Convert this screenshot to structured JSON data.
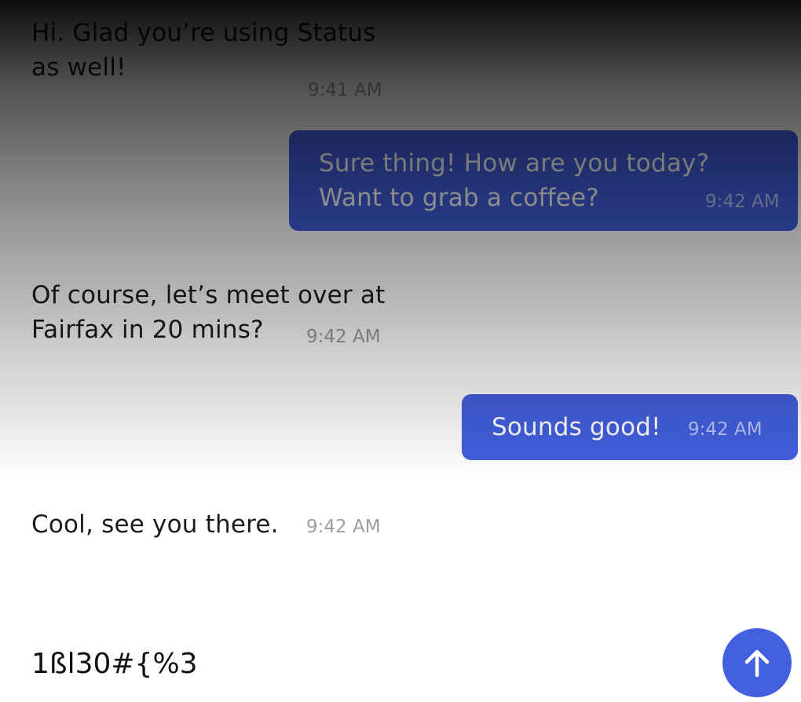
{
  "messages": [
    {
      "text": "Hi. Glad you’re using Status as well!",
      "time": "9:41 AM",
      "direction": "incoming"
    },
    {
      "text": "Sure thing! How are you today? Want to grab a coffee?",
      "time": "9:42 AM",
      "direction": "outgoing"
    },
    {
      "text": "Of course, let’s meet over at Fairfax in 20 mins?",
      "time": "9:42 AM",
      "direction": "incoming"
    },
    {
      "text": "Sounds good!",
      "time": "9:42 AM",
      "direction": "outgoing"
    },
    {
      "text": "Cool, see you there.",
      "time": "9:42 AM",
      "direction": "incoming"
    }
  ],
  "composer": {
    "value": "1ßl30#{%3"
  },
  "send_button": {
    "icon": "arrow-up-icon"
  },
  "colors": {
    "accent": "#4360df",
    "outgoing_text": "#ffffff",
    "incoming_text": "#1b1c1f",
    "timestamp": "#9a9da3"
  }
}
